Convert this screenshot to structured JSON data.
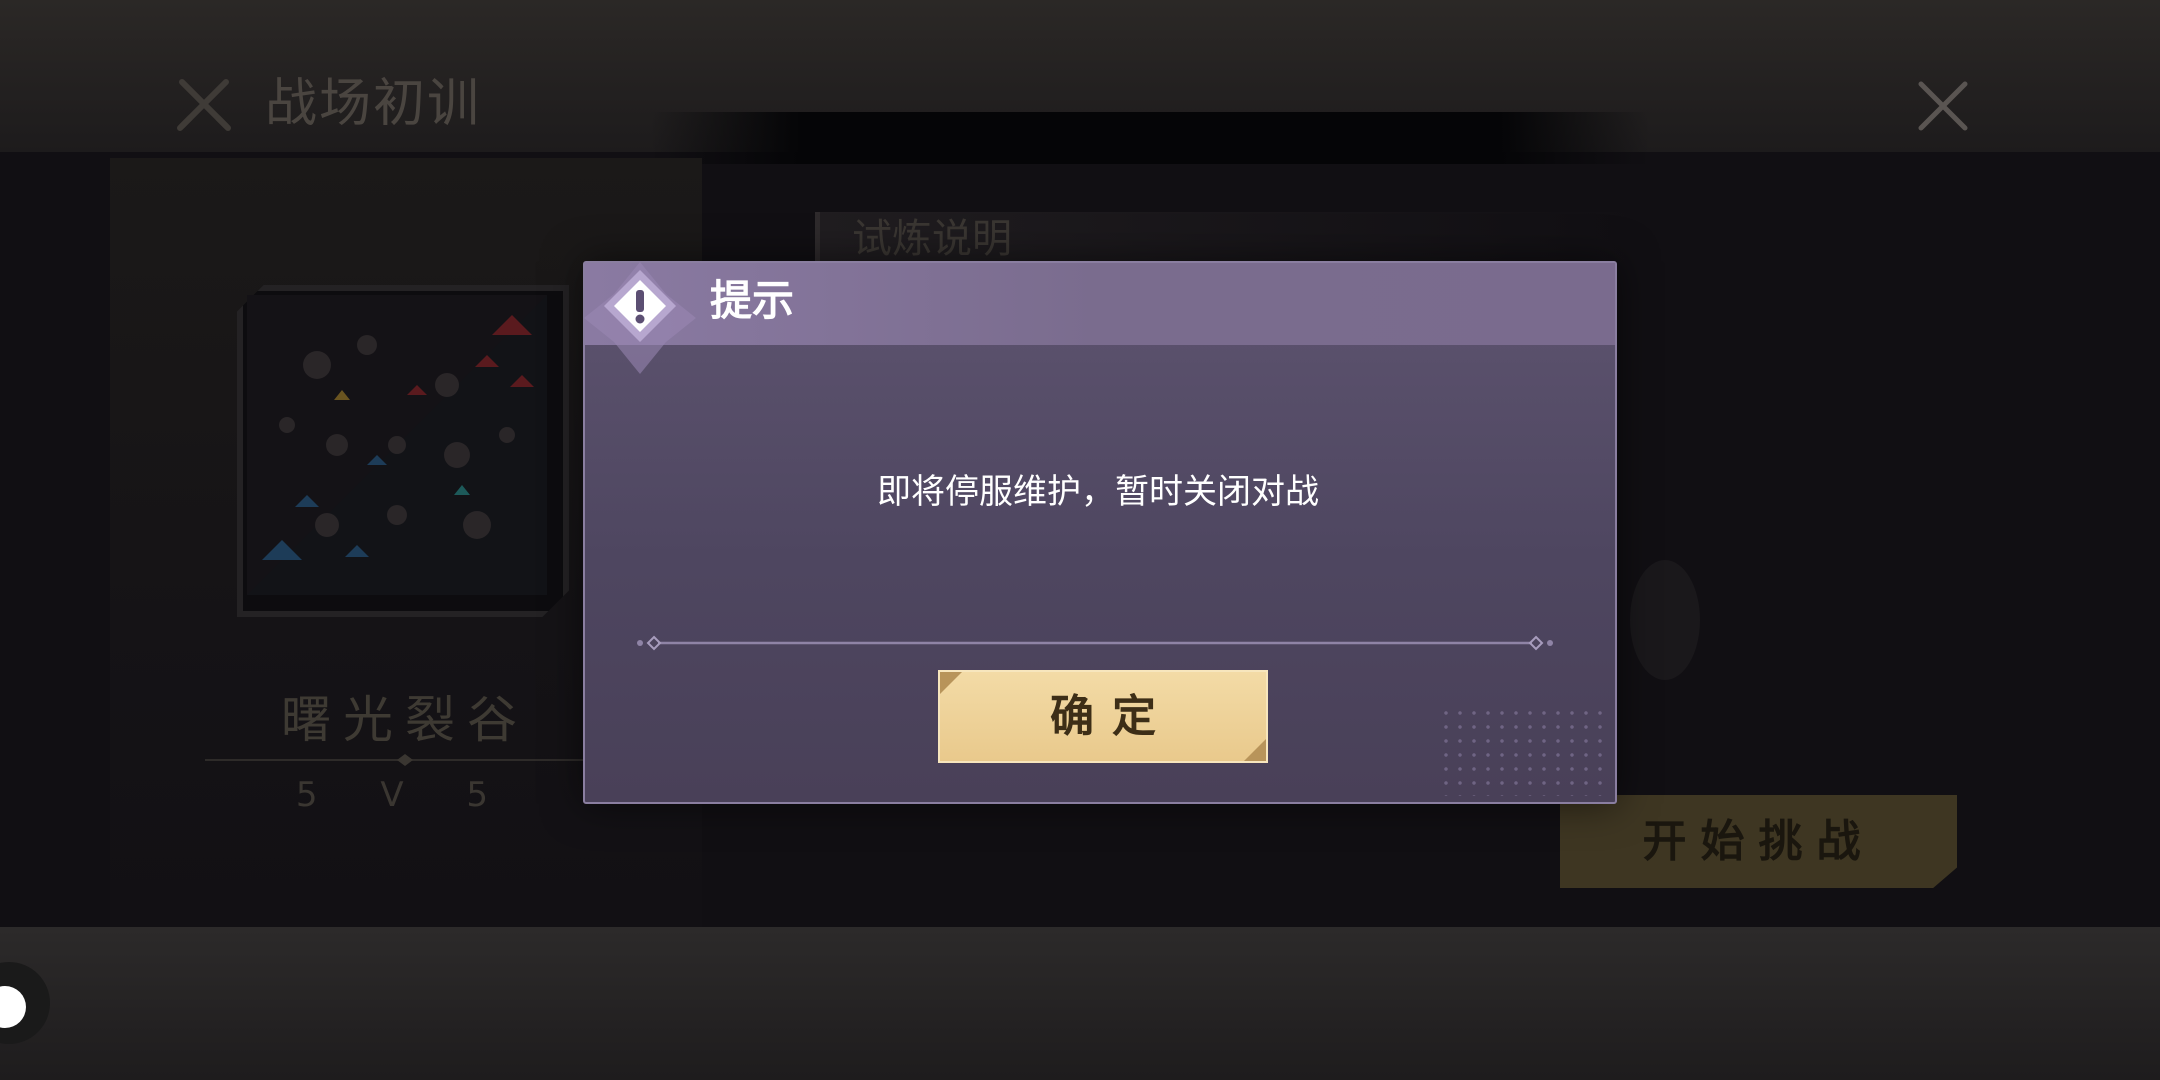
{
  "background": {
    "mode_title": "战场初训",
    "map": {
      "name": "曙光裂谷",
      "mode": "5 V 5"
    },
    "section_title": "试炼说明",
    "start_button_label": "开始挑战"
  },
  "dialog": {
    "title": "提示",
    "message": "即将停服维护，暂时关闭对战",
    "confirm_label": "确定"
  },
  "colors": {
    "dialog_header": "#7a6c8e",
    "dialog_body": "#564c68",
    "confirm_button": "#f0d49b",
    "red_team": "#7a1f24",
    "blue_team": "#1f4a6e"
  },
  "icons": [
    "crossed-swords-icon",
    "close-icon",
    "exclamation-diamond-icon"
  ]
}
